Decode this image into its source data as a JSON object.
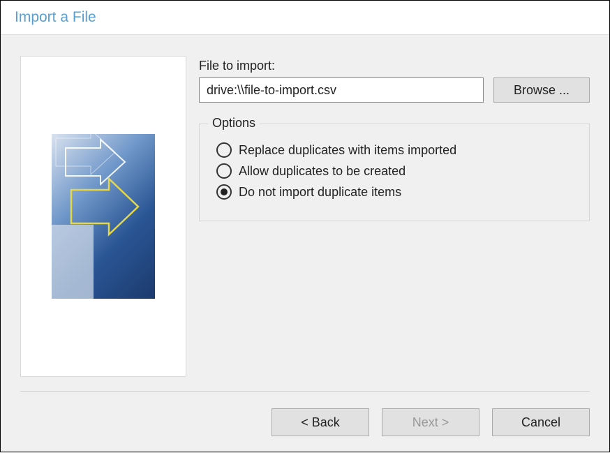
{
  "dialog": {
    "title": "Import a File"
  },
  "file": {
    "label": "File to import:",
    "value": "drive:\\\\file-to-import.csv",
    "browse_label": "Browse ..."
  },
  "options": {
    "legend": "Options",
    "items": [
      {
        "label": "Replace duplicates with items imported",
        "selected": false
      },
      {
        "label": "Allow duplicates to be created",
        "selected": false
      },
      {
        "label": "Do not import duplicate items",
        "selected": true
      }
    ]
  },
  "buttons": {
    "back": "< Back",
    "next": "Next >",
    "cancel": "Cancel"
  },
  "state": {
    "next_enabled": false
  }
}
